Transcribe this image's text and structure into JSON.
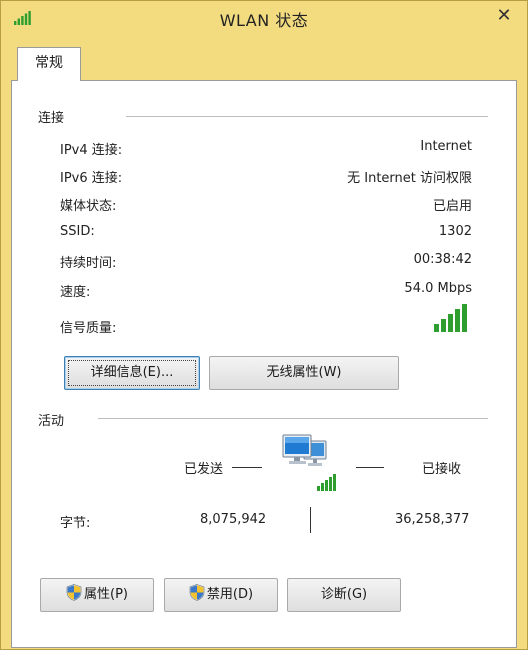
{
  "window": {
    "title": "WLAN 状态",
    "close_glyph": "✕"
  },
  "tab": {
    "label": "常规"
  },
  "connection": {
    "title": "连接",
    "rows": [
      {
        "label": "IPv4 连接:",
        "value": "Internet"
      },
      {
        "label": "IPv6 连接:",
        "value": "无 Internet 访问权限"
      },
      {
        "label": "媒体状态:",
        "value": "已启用"
      },
      {
        "label": "SSID:",
        "value": "1302"
      },
      {
        "label": "持续时间:",
        "value": "00:38:42"
      },
      {
        "label": "速度:",
        "value": "54.0 Mbps"
      }
    ],
    "signal_label": "信号质量:",
    "signal_bars": 5,
    "signal_bars_max": 5,
    "buttons": {
      "details": "详细信息(E)...",
      "wireless": "无线属性(W)"
    }
  },
  "activity": {
    "title": "活动",
    "sent_label": "已发送",
    "received_label": "已接收",
    "bytes_label": "字节:",
    "bytes_sent": "8,075,942",
    "bytes_received": "36,258,377"
  },
  "bottom_buttons": {
    "properties": "属性(P)",
    "disable": "禁用(D)",
    "diagnose": "诊断(G)"
  },
  "colors": {
    "signal_green": "#2e9e2e",
    "window_frame": "#f3dc80",
    "focus_blue": "#3c7fb1"
  }
}
